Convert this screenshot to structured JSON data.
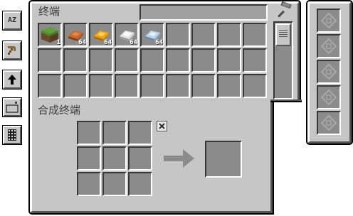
{
  "terminal": {
    "title": "终端",
    "search": {
      "value": ""
    },
    "items": [
      {
        "name": "grass-block",
        "count": "1"
      },
      {
        "name": "copper-ingot",
        "count": "64"
      },
      {
        "name": "gold-ingot",
        "count": "64"
      },
      {
        "name": "iron-ingot",
        "count": "64"
      },
      {
        "name": "aluminum-ingot",
        "count": "64"
      }
    ]
  },
  "crafting": {
    "title": "合成终端",
    "clear_icon": "x-icon",
    "arrow_icon": "right-arrow-icon"
  },
  "side_buttons": [
    {
      "name": "sort-az-button",
      "label": "AZ"
    },
    {
      "name": "view-mode-button",
      "icon": "pickaxe-icon"
    },
    {
      "name": "sort-direction-button",
      "icon": "up-arrow-icon"
    },
    {
      "name": "terminal-size-button",
      "icon": "size-icon"
    },
    {
      "name": "search-mode-button",
      "icon": "grid-icon"
    }
  ],
  "hammer_icon": "hammer-icon",
  "upgrade_slots": 5,
  "colors": {
    "panel": "#c6c6c6",
    "slot": "#8b8b8b",
    "title": "#3f3f3f"
  }
}
